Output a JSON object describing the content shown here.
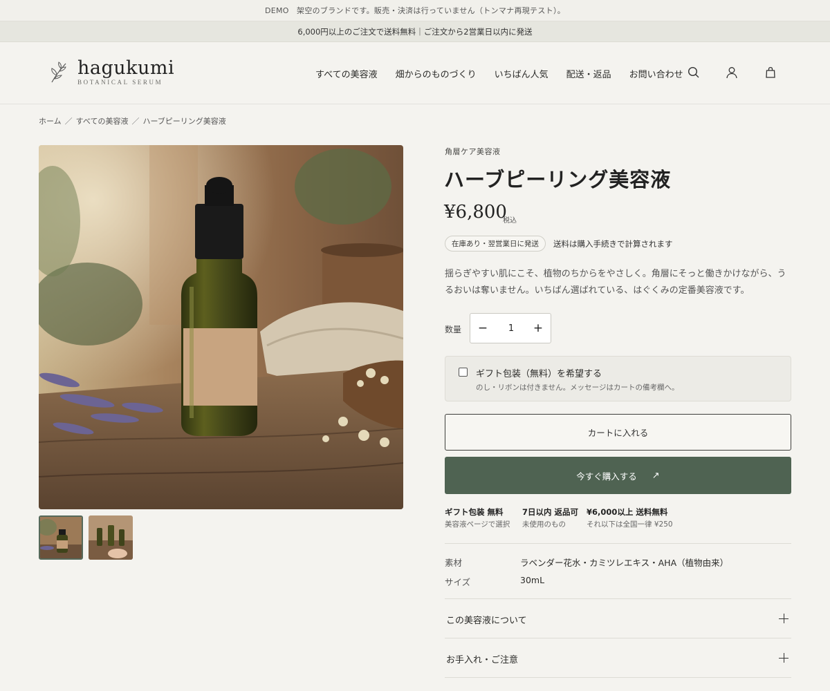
{
  "announcements": {
    "demo": "DEMO　架空のブランドです。販売・決済は行っていません（トンマナ再現テスト）。",
    "shipping": "6,000円以上のご注文で送料無料｜ご注文から2営業日以内に発送"
  },
  "logo": {
    "name": "hagukumi",
    "tagline": "BOTANICAL SERUM",
    "icon": "leaf-sprig-icon"
  },
  "nav": [
    "すべての美容液",
    "畑からのものづくり",
    "いちばん人気",
    "配送・返品",
    "お問い合わせ"
  ],
  "header_icons": [
    "search-icon",
    "account-icon",
    "bag-icon"
  ],
  "breadcrumb": {
    "home": "ホーム",
    "separator": "／",
    "category": "すべての美容液",
    "current": "ハーブピーリング美容液"
  },
  "product": {
    "category": "角層ケア美容液",
    "title": "ハーブピーリング美容液",
    "price": "¥6,800",
    "tax": "税込",
    "stock": "在庫あり・翌営業日に発送",
    "shipping_note": "送料は購入手続きで計算されます",
    "description": "揺らぎやすい肌にこそ、植物のちからをやさしく。角層にそっと働きかけながら、うるおいは奪いません。いちばん選ばれている、はぐくみの定番美容液です。",
    "quantity_label": "数量",
    "quantity": "1",
    "minus": "−",
    "plus": "+",
    "thumbnail_count": 2,
    "active_thumbnail": 1
  },
  "gift": {
    "label": "ギフト包装（無料）を希望する",
    "sub": "のし・リボンは付きません。メッセージはカートの備考欄へ。",
    "checked": false
  },
  "buttons": {
    "add_to_cart": "カートに入れる",
    "buy_now": "今すぐ購入する",
    "buy_now_icon": "↗"
  },
  "features": [
    {
      "title": "ギフト包装 無料",
      "sub": "美容液ページで選択"
    },
    {
      "title": "7日以内 返品可",
      "sub": "未使用のもの"
    },
    {
      "title": "¥6,000以上 送料無料",
      "sub": "それ以下は全国一律 ¥250"
    }
  ],
  "specs": [
    {
      "key": "素材",
      "value": "ラベンダー花水・カミツレエキス・AHA（植物由来）"
    },
    {
      "key": "サイズ",
      "value": "30mL"
    }
  ],
  "accordions": [
    "この美容液について",
    "お手入れ・ご注意"
  ],
  "colors": {
    "background": "#f4f3ef",
    "accent": "#4f6352",
    "text": "#2c2c2a"
  }
}
